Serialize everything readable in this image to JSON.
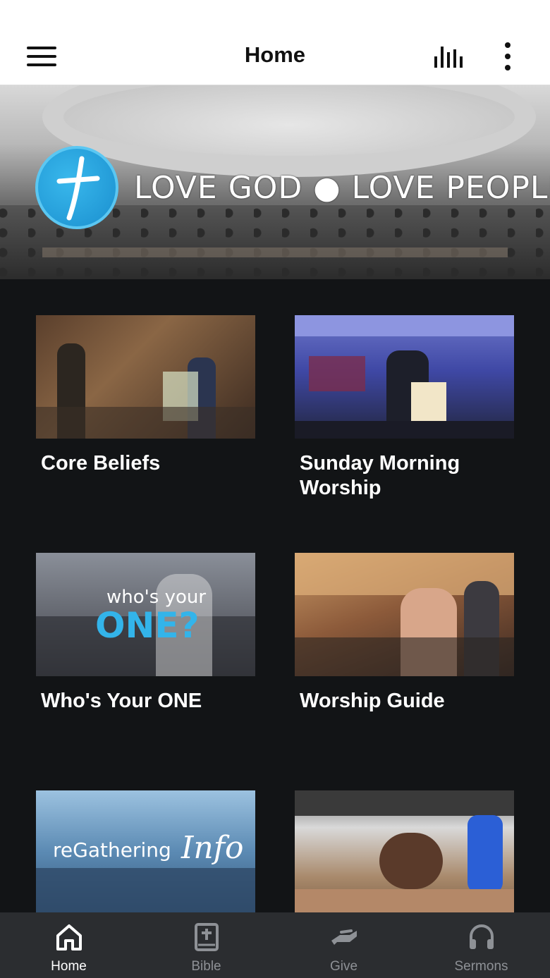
{
  "header": {
    "title": "Home"
  },
  "hero": {
    "tagline": "LOVE GOD ● LOVE PEOPLE"
  },
  "cards": [
    {
      "title": "Core Beliefs"
    },
    {
      "title": "Sunday Morning Worship"
    },
    {
      "title": "Who's Your ONE",
      "overlay_line1": "who's your",
      "overlay_line2": "ONE?"
    },
    {
      "title": "Worship Guide"
    },
    {
      "title": "",
      "overlay_line1": "reGathering",
      "overlay_line2": "Info"
    },
    {
      "title": ""
    }
  ],
  "tabs": [
    {
      "label": "Home",
      "icon": "home-icon",
      "active": true
    },
    {
      "label": "Bible",
      "icon": "bible-icon",
      "active": false
    },
    {
      "label": "Give",
      "icon": "give-icon",
      "active": false
    },
    {
      "label": "Sermons",
      "icon": "headphones-icon",
      "active": false
    }
  ],
  "colors": {
    "accent": "#33b4ea",
    "background": "#121416",
    "tab_bar": "#2b2d30"
  }
}
